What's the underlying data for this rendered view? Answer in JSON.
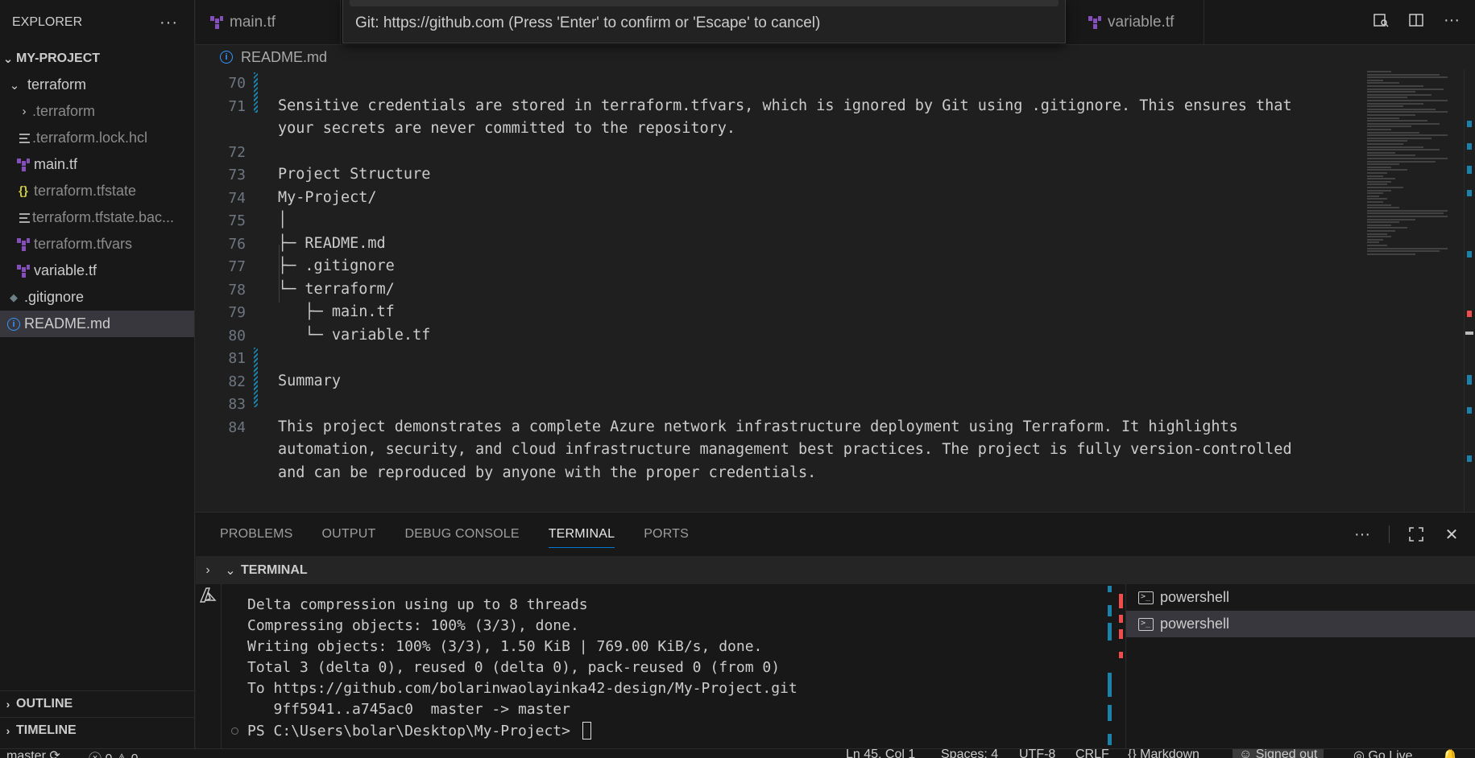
{
  "sidebar": {
    "title": "EXPLORER",
    "more_icon": "ellipsis-icon",
    "project": "MY-PROJECT",
    "items": [
      {
        "label": "terraform",
        "type": "folder-open"
      },
      {
        "label": ".terraform",
        "type": "folder-closed"
      },
      {
        "label": ".terraform.lock.hcl",
        "type": "lines"
      },
      {
        "label": "main.tf",
        "type": "terraform"
      },
      {
        "label": "terraform.tfstate",
        "type": "json"
      },
      {
        "label": "terraform.tfstate.bac...",
        "type": "lines"
      },
      {
        "label": "terraform.tfvars",
        "type": "terraform"
      },
      {
        "label": "variable.tf",
        "type": "terraform"
      },
      {
        "label": ".gitignore",
        "type": "git"
      },
      {
        "label": "README.md",
        "type": "info"
      }
    ],
    "outline": "OUTLINE",
    "timeline": "TIMELINE"
  },
  "tabs": [
    {
      "label": "main.tf"
    },
    {
      "label": "variable.tf"
    }
  ],
  "command_palette": {
    "message": "Git: https://github.com (Press 'Enter' to confirm or 'Escape' to cancel)"
  },
  "breadcrumb": "README.md",
  "editor": {
    "lines": [
      {
        "num": "70",
        "text": ""
      },
      {
        "num": "71",
        "text": "Sensitive credentials are stored in terraform.tfvars, which is ignored by Git using .gitignore. This ensures that"
      },
      {
        "num": "",
        "text": "your secrets are never committed to the repository."
      },
      {
        "num": "72",
        "text": ""
      },
      {
        "num": "73",
        "text": "Project Structure"
      },
      {
        "num": "74",
        "text": "My-Project/"
      },
      {
        "num": "75",
        "text": "│"
      },
      {
        "num": "76",
        "text": "├─ README.md"
      },
      {
        "num": "77",
        "text": "├─ .gitignore"
      },
      {
        "num": "78",
        "text": "└─ terraform/"
      },
      {
        "num": "79",
        "text": "   ├─ main.tf"
      },
      {
        "num": "80",
        "text": "   └─ variable.tf"
      },
      {
        "num": "81",
        "text": ""
      },
      {
        "num": "82",
        "text": "Summary"
      },
      {
        "num": "83",
        "text": ""
      },
      {
        "num": "84",
        "text": "This project demonstrates a complete Azure network infrastructure deployment using Terraform. It highlights"
      },
      {
        "num": "",
        "text": "automation, security, and cloud infrastructure management best practices. The project is fully version-controlled"
      },
      {
        "num": "",
        "text": "and can be reproduced by anyone with the proper credentials."
      }
    ]
  },
  "panel": {
    "tabs": [
      "PROBLEMS",
      "OUTPUT",
      "DEBUG CONSOLE",
      "TERMINAL",
      "PORTS"
    ],
    "active_tab": "TERMINAL",
    "section_title": "TERMINAL",
    "terminal_lines": [
      "Delta compression using up to 8 threads",
      "Compressing objects: 100% (3/3), done.",
      "Writing objects: 100% (3/3), 1.50 KiB | 769.00 KiB/s, done.",
      "Total 3 (delta 0), reused 0 (delta 0), pack-reused 0 (from 0)",
      "To https://github.com/bolarinwaolayinka42-design/My-Project.git",
      "   9ff5941..a745ac0  master -> master",
      "PS C:\\Users\\bolar\\Desktop\\My-Project> "
    ],
    "terminals": [
      {
        "label": "powershell",
        "selected": false
      },
      {
        "label": "powershell",
        "selected": true
      }
    ]
  },
  "status_bar": {
    "branch": "master",
    "errors": "0",
    "warnings": "0",
    "position": "Ln 45, Col 1",
    "spaces": "Spaces: 4",
    "encoding": "UTF-8",
    "eol": "CRLF",
    "language": "Markdown",
    "account": "Signed out",
    "live": "Go Live"
  },
  "colors": {
    "accent": "#0078d4",
    "terraform": "#844fba",
    "info": "#3794ff",
    "modified_gutter": "#1b81a8",
    "error_mark": "#f14c4c"
  }
}
